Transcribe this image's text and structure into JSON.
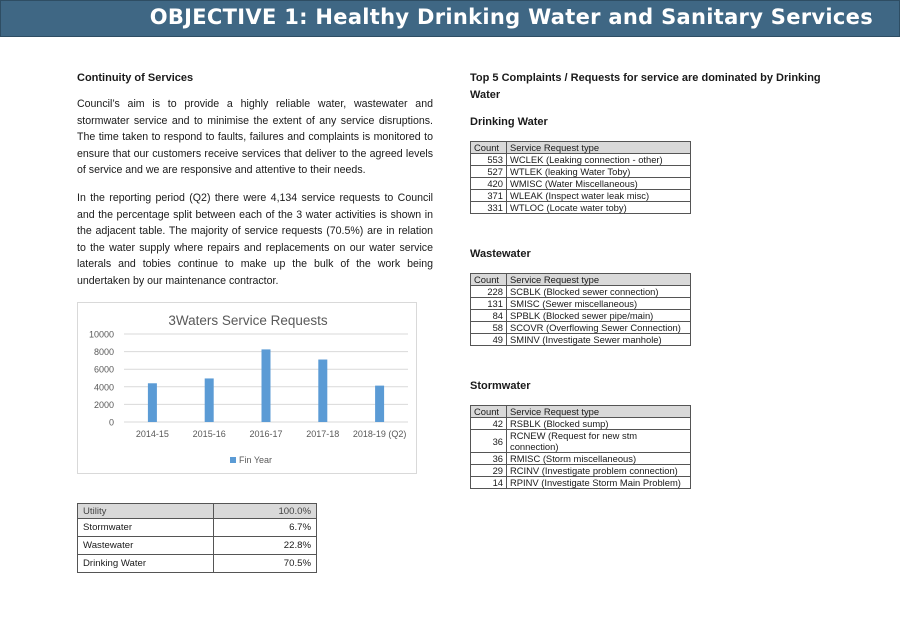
{
  "banner": {
    "title": "OBJECTIVE 1: Healthy Drinking Water and Sanitary Services"
  },
  "left": {
    "heading": "Continuity of Services",
    "paragraph1": "Council’s aim is to provide a highly reliable water, wastewater and stormwater service and to minimise the extent of any service disruptions. The time taken to respond to faults, failures and complaints is monitored to ensure that our customers receive services that deliver to the agreed levels of service and we are responsive and attentive to their needs.",
    "paragraph2": "In the reporting period (Q2) there were 4,134 service requests to Council and the percentage split between each of the 3 water activities is shown in the adjacent table. The majority of service requests (70.5%) are in relation to the water supply where repairs and replacements on our water service laterals and tobies continue to make up the bulk of the work being undertaken by our maintenance contractor."
  },
  "chart_data": {
    "type": "bar",
    "title": "3Waters Service Requests",
    "categories": [
      "2014-15",
      "2015-16",
      "2016-17",
      "2017-18",
      "2018-19 (Q2)"
    ],
    "series": [
      {
        "name": "Fin Year",
        "values": [
          4400,
          4950,
          8250,
          7100,
          4134
        ]
      }
    ],
    "ylim": [
      0,
      10000
    ],
    "yticks": [
      0,
      2000,
      4000,
      6000,
      8000,
      10000
    ],
    "grid": true,
    "legend": "bottom",
    "bar_color": "#5b9bd5"
  },
  "utility_table": {
    "header": {
      "label": "Utility",
      "value": "100.0%"
    },
    "rows": [
      {
        "label": "Stormwater",
        "value": "6.7%"
      },
      {
        "label": "Wastewater",
        "value": "22.8%"
      },
      {
        "label": "Drinking Water",
        "value": "70.5%"
      }
    ]
  },
  "right": {
    "heading": "Top 5 Complaints / Requests for service are dominated by Drinking Water",
    "sections": [
      {
        "title": "Drinking Water",
        "header": [
          "Count",
          "Service Request type"
        ],
        "rows": [
          [
            "553",
            "WCLEK (Leaking connection - other)"
          ],
          [
            "527",
            "WTLEK (leaking Water Toby)"
          ],
          [
            "420",
            "WMISC (Water Miscellaneous)"
          ],
          [
            "371",
            "WLEAK (Inspect water leak misc)"
          ],
          [
            "331",
            "WTLOC (Locate water toby)"
          ]
        ]
      },
      {
        "title": "Wastewater",
        "header": [
          "Count",
          "Service Request type"
        ],
        "rows": [
          [
            "228",
            "SCBLK (Blocked sewer connection)"
          ],
          [
            "131",
            "SMISC (Sewer miscellaneous)"
          ],
          [
            "84",
            "SPBLK (Blocked sewer pipe/main)"
          ],
          [
            "58",
            "SCOVR (Overflowing Sewer Connection)"
          ],
          [
            "49",
            "SMINV (Investigate Sewer manhole)"
          ]
        ]
      },
      {
        "title": "Stormwater",
        "header": [
          "Count",
          "Service Request type"
        ],
        "rows": [
          [
            "42",
            "RSBLK (Blocked sump)"
          ],
          [
            "36",
            "RCNEW (Request for new stm connection)"
          ],
          [
            "36",
            "RMISC (Storm miscellaneous)"
          ],
          [
            "29",
            "RCINV (Investigate problem connection)"
          ],
          [
            "14",
            "RPINV (Investigate Storm Main Problem)"
          ]
        ]
      }
    ]
  }
}
